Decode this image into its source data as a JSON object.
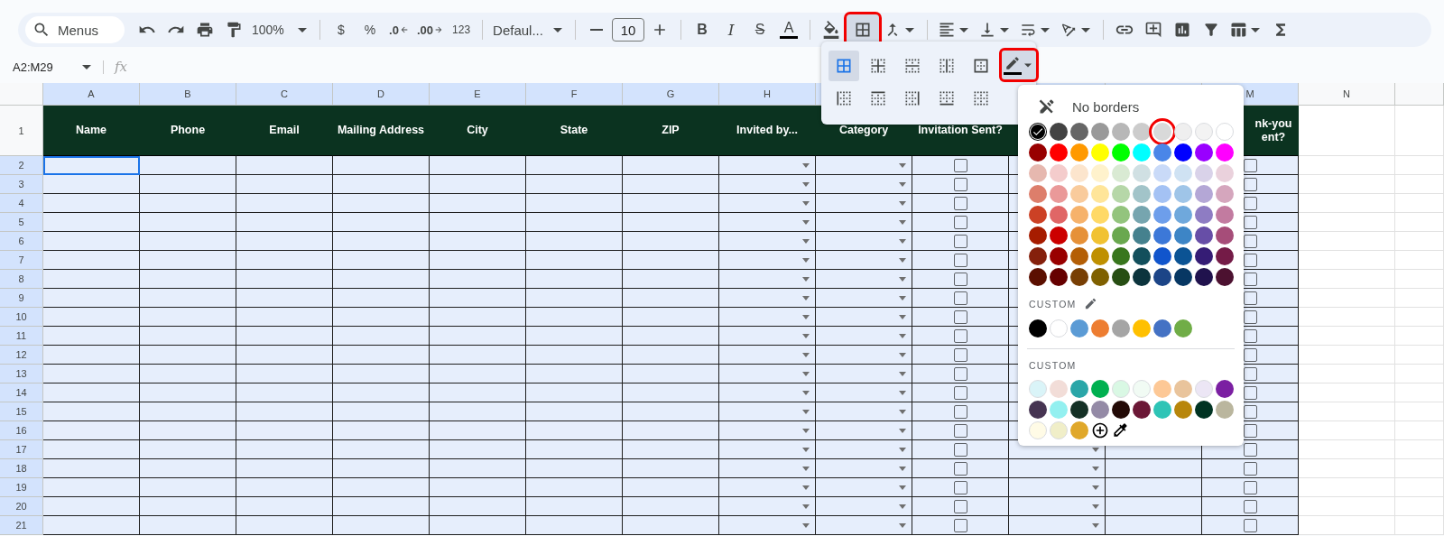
{
  "toolbar": {
    "search": {
      "placeholder": "Menus"
    },
    "zoom": "100%",
    "currency": "$",
    "percent": "%",
    "decrease_decimals": ".0",
    "increase_decimals": ".00",
    "number_format": "123",
    "font": "Defaul...",
    "font_size": "10",
    "bold": "B",
    "italic": "I",
    "strikethrough": "S",
    "text_color": "A",
    "borders_open": true,
    "borders_highlighted": true
  },
  "formula_bar": {
    "name_box": "A2:M29",
    "fx": "fx"
  },
  "columns": [
    {
      "letter": "A",
      "header": "Name",
      "kind": "text"
    },
    {
      "letter": "B",
      "header": "Phone",
      "kind": "text"
    },
    {
      "letter": "C",
      "header": "Email",
      "kind": "text"
    },
    {
      "letter": "D",
      "header": "Mailing Address",
      "kind": "text"
    },
    {
      "letter": "E",
      "header": "City",
      "kind": "text"
    },
    {
      "letter": "F",
      "header": "State",
      "kind": "text"
    },
    {
      "letter": "G",
      "header": "ZIP",
      "kind": "text"
    },
    {
      "letter": "H",
      "header": "Invited by...",
      "kind": "dropdown"
    },
    {
      "header": "Category",
      "kind": "dropdown"
    },
    {
      "header": "Invitation Sent?",
      "kind": "checkbox"
    },
    {
      "kind": "dropdown"
    },
    {
      "kind": "text"
    },
    {
      "letter": "M",
      "header": "nk-you\nent?",
      "kind": "checkbox"
    },
    {
      "letter": "N",
      "kind": "blank"
    },
    {
      "kind": "blank"
    }
  ],
  "rows": [
    {
      "number": "2",
      "active": true,
      "checked": [
        false,
        false
      ]
    },
    {
      "number": "3",
      "active": false,
      "checked": [
        false,
        false
      ]
    },
    {
      "number": "4",
      "active": false,
      "checked": [
        false,
        false
      ]
    },
    {
      "number": "5",
      "active": false,
      "checked": [
        false,
        false
      ]
    },
    {
      "number": "6",
      "active": false,
      "checked": [
        false,
        false
      ]
    },
    {
      "number": "7",
      "active": false,
      "checked": [
        false,
        false
      ]
    },
    {
      "number": "8",
      "active": false,
      "checked": [
        false,
        false
      ]
    },
    {
      "number": "9",
      "active": false,
      "checked": [
        false,
        false
      ]
    },
    {
      "number": "10",
      "active": false,
      "checked": [
        false,
        false
      ]
    },
    {
      "number": "11",
      "active": false,
      "checked": [
        false,
        false
      ]
    },
    {
      "number": "12",
      "active": false,
      "checked": [
        false,
        false
      ]
    },
    {
      "number": "13",
      "active": false,
      "checked": [
        false,
        false
      ]
    },
    {
      "number": "14",
      "active": false,
      "checked": [
        false,
        false
      ]
    },
    {
      "number": "15",
      "active": false,
      "checked": [
        false,
        false
      ]
    },
    {
      "number": "16",
      "active": false,
      "checked": [
        false,
        false
      ]
    },
    {
      "number": "17",
      "active": false,
      "checked": [
        false,
        false
      ]
    },
    {
      "number": "18",
      "active": false,
      "checked": [
        false,
        false
      ]
    },
    {
      "number": "19",
      "active": false,
      "checked": [
        false,
        false
      ]
    },
    {
      "number": "20",
      "active": false,
      "checked": [
        false,
        false
      ]
    },
    {
      "number": "21",
      "active": false,
      "checked": [
        false,
        false
      ]
    }
  ],
  "header_row_number": "1",
  "borders_menu": {
    "options": [
      {
        "kind": "all",
        "selected": true
      },
      {
        "kind": "inner",
        "selected": false
      },
      {
        "kind": "horizontal",
        "selected": false
      },
      {
        "kind": "vertical",
        "selected": false
      },
      {
        "kind": "outer",
        "selected": false
      },
      {
        "kind": "left",
        "selected": false
      },
      {
        "kind": "top",
        "selected": false
      },
      {
        "kind": "right",
        "selected": false
      },
      {
        "kind": "bottom",
        "selected": false
      },
      {
        "kind": "clear",
        "selected": false
      }
    ],
    "pen_highlighted": true
  },
  "color_menu": {
    "no_borders": "No borders",
    "palette": [
      [
        {
          "color": "#000000",
          "selected": true,
          "highlighted": false
        },
        {
          "color": "#434343",
          "selected": false,
          "highlighted": false
        },
        {
          "color": "#666666",
          "selected": false,
          "highlighted": false
        },
        {
          "color": "#999999",
          "selected": false,
          "highlighted": false
        },
        {
          "color": "#b7b7b7",
          "selected": false,
          "highlighted": false
        },
        {
          "color": "#cccccc",
          "selected": false,
          "highlighted": false
        },
        {
          "color": "#d9d9d9",
          "selected": false,
          "highlighted": true
        },
        {
          "color": "#efefef",
          "selected": false,
          "highlighted": false
        },
        {
          "color": "#f3f3f3",
          "selected": false,
          "highlighted": false
        },
        {
          "color": "#ffffff",
          "selected": false,
          "highlighted": false
        }
      ],
      [
        {
          "color": "#980000",
          "selected": false,
          "highlighted": false
        },
        {
          "color": "#ff0000",
          "selected": false,
          "highlighted": false
        },
        {
          "color": "#ff9900",
          "selected": false,
          "highlighted": false
        },
        {
          "color": "#ffff00",
          "selected": false,
          "highlighted": false
        },
        {
          "color": "#00ff00",
          "selected": false,
          "highlighted": false
        },
        {
          "color": "#00ffff",
          "selected": false,
          "highlighted": false
        },
        {
          "color": "#4a86e8",
          "selected": false,
          "highlighted": false
        },
        {
          "color": "#0000ff",
          "selected": false,
          "highlighted": false
        },
        {
          "color": "#9900ff",
          "selected": false,
          "highlighted": false
        },
        {
          "color": "#ff00ff",
          "selected": false,
          "highlighted": false
        }
      ],
      [
        {
          "color": "#e6b8af",
          "selected": false,
          "highlighted": false
        },
        {
          "color": "#f4cccc",
          "selected": false,
          "highlighted": false
        },
        {
          "color": "#fce5cd",
          "selected": false,
          "highlighted": false
        },
        {
          "color": "#fff2cc",
          "selected": false,
          "highlighted": false
        },
        {
          "color": "#d9ead3",
          "selected": false,
          "highlighted": false
        },
        {
          "color": "#d0e0e3",
          "selected": false,
          "highlighted": false
        },
        {
          "color": "#c9daf8",
          "selected": false,
          "highlighted": false
        },
        {
          "color": "#cfe2f3",
          "selected": false,
          "highlighted": false
        },
        {
          "color": "#d9d2e9",
          "selected": false,
          "highlighted": false
        },
        {
          "color": "#ead1dc",
          "selected": false,
          "highlighted": false
        }
      ],
      [
        {
          "color": "#dd7e6b",
          "selected": false,
          "highlighted": false
        },
        {
          "color": "#ea9999",
          "selected": false,
          "highlighted": false
        },
        {
          "color": "#f9cb9c",
          "selected": false,
          "highlighted": false
        },
        {
          "color": "#ffe599",
          "selected": false,
          "highlighted": false
        },
        {
          "color": "#b6d7a8",
          "selected": false,
          "highlighted": false
        },
        {
          "color": "#a2c4c9",
          "selected": false,
          "highlighted": false
        },
        {
          "color": "#a4c2f4",
          "selected": false,
          "highlighted": false
        },
        {
          "color": "#9fc5e8",
          "selected": false,
          "highlighted": false
        },
        {
          "color": "#b4a7d6",
          "selected": false,
          "highlighted": false
        },
        {
          "color": "#d5a6bd",
          "selected": false,
          "highlighted": false
        }
      ],
      [
        {
          "color": "#cc4125",
          "selected": false,
          "highlighted": false
        },
        {
          "color": "#e06666",
          "selected": false,
          "highlighted": false
        },
        {
          "color": "#f6b26b",
          "selected": false,
          "highlighted": false
        },
        {
          "color": "#ffd966",
          "selected": false,
          "highlighted": false
        },
        {
          "color": "#93c47d",
          "selected": false,
          "highlighted": false
        },
        {
          "color": "#76a5af",
          "selected": false,
          "highlighted": false
        },
        {
          "color": "#6d9eeb",
          "selected": false,
          "highlighted": false
        },
        {
          "color": "#6fa8dc",
          "selected": false,
          "highlighted": false
        },
        {
          "color": "#8e7cc3",
          "selected": false,
          "highlighted": false
        },
        {
          "color": "#c27ba0",
          "selected": false,
          "highlighted": false
        }
      ],
      [
        {
          "color": "#a61c00",
          "selected": false,
          "highlighted": false
        },
        {
          "color": "#cc0000",
          "selected": false,
          "highlighted": false
        },
        {
          "color": "#e69138",
          "selected": false,
          "highlighted": false
        },
        {
          "color": "#f1c232",
          "selected": false,
          "highlighted": false
        },
        {
          "color": "#6aa84f",
          "selected": false,
          "highlighted": false
        },
        {
          "color": "#45818e",
          "selected": false,
          "highlighted": false
        },
        {
          "color": "#3c78d8",
          "selected": false,
          "highlighted": false
        },
        {
          "color": "#3d85c6",
          "selected": false,
          "highlighted": false
        },
        {
          "color": "#674ea7",
          "selected": false,
          "highlighted": false
        },
        {
          "color": "#a64d79",
          "selected": false,
          "highlighted": false
        }
      ],
      [
        {
          "color": "#85200c",
          "selected": false,
          "highlighted": false
        },
        {
          "color": "#990000",
          "selected": false,
          "highlighted": false
        },
        {
          "color": "#b45f06",
          "selected": false,
          "highlighted": false
        },
        {
          "color": "#bf9000",
          "selected": false,
          "highlighted": false
        },
        {
          "color": "#38761d",
          "selected": false,
          "highlighted": false
        },
        {
          "color": "#134f5c",
          "selected": false,
          "highlighted": false
        },
        {
          "color": "#1155cc",
          "selected": false,
          "highlighted": false
        },
        {
          "color": "#0b5394",
          "selected": false,
          "highlighted": false
        },
        {
          "color": "#351c75",
          "selected": false,
          "highlighted": false
        },
        {
          "color": "#741b47",
          "selected": false,
          "highlighted": false
        }
      ],
      [
        {
          "color": "#5b0f00",
          "selected": false,
          "highlighted": false
        },
        {
          "color": "#660000",
          "selected": false,
          "highlighted": false
        },
        {
          "color": "#783f04",
          "selected": false,
          "highlighted": false
        },
        {
          "color": "#7f6000",
          "selected": false,
          "highlighted": false
        },
        {
          "color": "#274e13",
          "selected": false,
          "highlighted": false
        },
        {
          "color": "#0c343d",
          "selected": false,
          "highlighted": false
        },
        {
          "color": "#1c4587",
          "selected": false,
          "highlighted": false
        },
        {
          "color": "#073763",
          "selected": false,
          "highlighted": false
        },
        {
          "color": "#20124d",
          "selected": false,
          "highlighted": false
        },
        {
          "color": "#4c1130",
          "selected": false,
          "highlighted": false
        }
      ]
    ],
    "custom_label_1": "CUSTOM",
    "custom_1": [
      {
        "color": "#000000",
        "selected": false
      },
      {
        "color": "#ffffff",
        "selected": false
      },
      {
        "color": "#5b9bd5",
        "selected": false
      },
      {
        "color": "#ed7d31",
        "selected": false
      },
      {
        "color": "#a5a5a5",
        "selected": false
      },
      {
        "color": "#ffc000",
        "selected": false
      },
      {
        "color": "#4472c4",
        "selected": false
      },
      {
        "color": "#70ad47",
        "selected": false
      }
    ],
    "custom_label_2": "CUSTOM",
    "custom_2": [
      {
        "color": "#daf4f8",
        "selected": false
      },
      {
        "color": "#f2ddd8",
        "selected": false
      },
      {
        "color": "#2aa6a8",
        "selected": false
      },
      {
        "color": "#00b050",
        "selected": false
      },
      {
        "color": "#d9f8e4",
        "selected": false
      },
      {
        "color": "#f1fbf4",
        "selected": false
      },
      {
        "color": "#fdc896",
        "selected": false
      },
      {
        "color": "#e9c49c",
        "selected": false
      },
      {
        "color": "#ece6f5",
        "selected": false
      },
      {
        "color": "#7b1fa2",
        "selected": false
      },
      {
        "color": "#463452",
        "selected": false
      },
      {
        "color": "#93f0f0",
        "selected": false
      },
      {
        "color": "#153126",
        "selected": false
      },
      {
        "color": "#948aa6",
        "selected": false
      },
      {
        "color": "#230a06",
        "selected": false
      },
      {
        "color": "#6b1836",
        "selected": false
      },
      {
        "color": "#2ec4b6",
        "selected": false
      },
      {
        "color": "#b8860b",
        "selected": false
      },
      {
        "color": "#003322",
        "selected": false
      },
      {
        "color": "#bab69e",
        "selected": false
      },
      {
        "color": "#fffbe6",
        "selected": false
      },
      {
        "color": "#f0eec8",
        "selected": false
      },
      {
        "color": "#e0a82a",
        "selected": false
      }
    ]
  }
}
